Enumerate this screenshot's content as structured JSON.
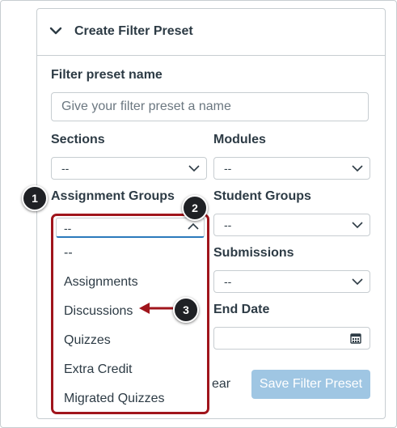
{
  "panel": {
    "title": "Create Filter Preset"
  },
  "form": {
    "name_label": "Filter preset name",
    "name_placeholder": "Give your filter preset a name",
    "sections_label": "Sections",
    "sections_value": "--",
    "modules_label": "Modules",
    "modules_value": "--",
    "assignment_groups_label": "Assignment Groups",
    "assignment_groups_value": "--",
    "student_groups_label": "Student Groups",
    "student_groups_value": "--",
    "submissions_label": "Submissions",
    "submissions_value": "--",
    "end_date_label": "End Date",
    "end_date_value": ""
  },
  "dropdown": {
    "options": [
      "--",
      "Assignments",
      "Discussions",
      "Quizzes",
      "Extra Credit",
      "Migrated Quizzes"
    ]
  },
  "buttons": {
    "clear_visible_text": "ear",
    "save": "Save Filter Preset"
  },
  "callouts": [
    "1",
    "2",
    "3"
  ],
  "colors": {
    "highlight": "#a0151c",
    "save_button": "#9fc6e3",
    "focus": "#2b7abc"
  },
  "icons": [
    "chevron-down-icon",
    "chevron-up-icon",
    "calendar-icon",
    "arrow-left-icon"
  ]
}
